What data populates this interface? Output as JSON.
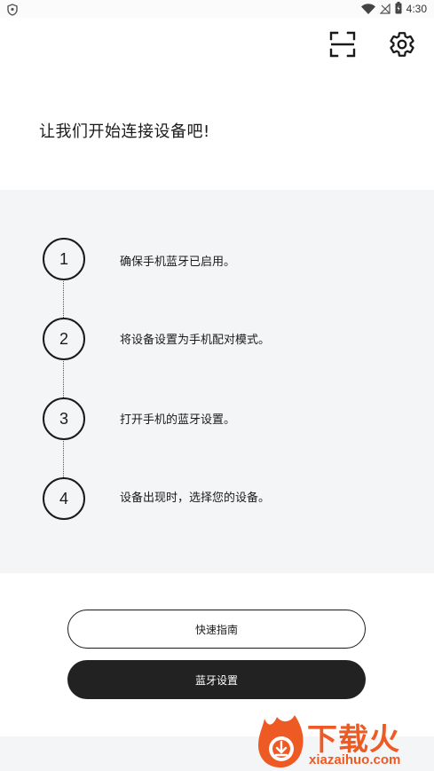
{
  "status_bar": {
    "time": "4:30",
    "icons": [
      "shield-icon",
      "wifi-icon",
      "signal-off-icon",
      "battery-icon"
    ]
  },
  "header": {
    "scan_icon": "scan-icon",
    "settings_icon": "gear-icon"
  },
  "page": {
    "title": "让我们开始连接设备吧!"
  },
  "steps": [
    {
      "number": "1",
      "text": "确保手机蓝牙已启用。"
    },
    {
      "number": "2",
      "text": "将设备设置为手机配对模式。"
    },
    {
      "number": "3",
      "text": "打开手机的蓝牙设置。"
    },
    {
      "number": "4",
      "text": "设备出现时，选择您的设备。"
    }
  ],
  "buttons": {
    "quick_guide": "快速指南",
    "bluetooth_settings": "蓝牙设置"
  },
  "watermark": {
    "title": "下载火",
    "subtitle": "xiazaihuo.com"
  },
  "colors": {
    "panel_bg": "#f4f5f7",
    "dark_button": "#222222",
    "watermark": "#ee5a24"
  }
}
